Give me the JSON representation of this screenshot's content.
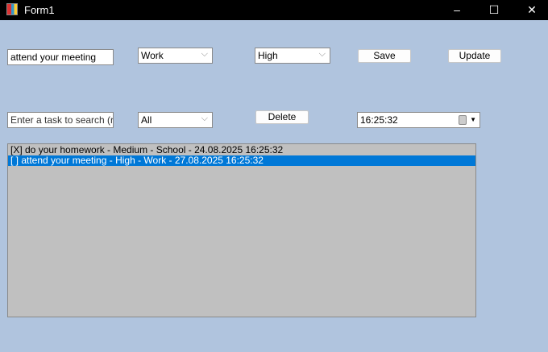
{
  "window": {
    "title": "Form1",
    "min": "–",
    "max": "☐",
    "close": "✕"
  },
  "form": {
    "task_input": "attend your meeting",
    "category_select": "Work",
    "priority_select": "High",
    "save_label": "Save",
    "update_label": "Update",
    "search_placeholder": "Enter a task to search (refi",
    "filter_select": "All",
    "delete_label": "Delete",
    "time_picker": "16:25:32"
  },
  "tasks": [
    {
      "text": "[X] do your homework - Medium - School - 24.08.2025 16:25:32",
      "selected": false
    },
    {
      "text": "[ ] attend your meeting - High - Work - 27.08.2025 16:25:32",
      "selected": true
    }
  ]
}
